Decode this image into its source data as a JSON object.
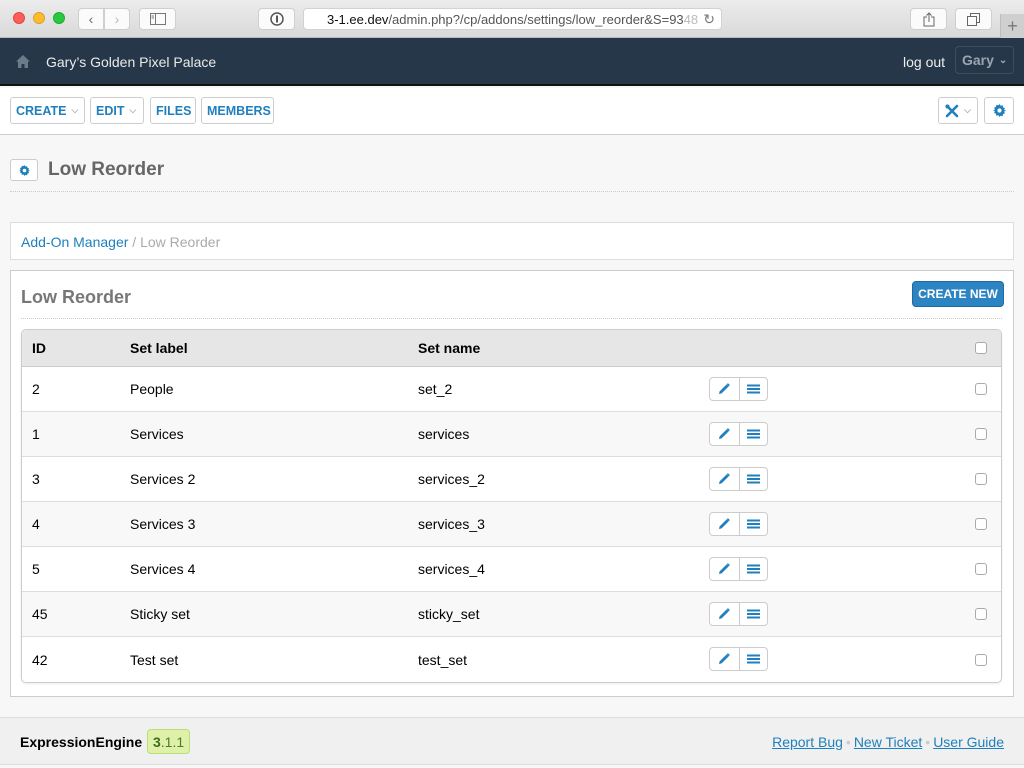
{
  "browser": {
    "url_host": "3-1.ee.dev",
    "url_path": "/admin.php?/cp/addons/settings/low_reorder&S=93",
    "url_fade": "48"
  },
  "header": {
    "site_name": "Gary’s Golden Pixel Palace",
    "logout_label": "log out",
    "user_label": "Gary"
  },
  "nav": {
    "create_label": "CREATE",
    "edit_label": "EDIT",
    "files_label": "FILES",
    "members_label": "MEMBERS"
  },
  "page": {
    "title": "Low Reorder"
  },
  "breadcrumb": {
    "parent": "Add-On Manager",
    "separator": " / ",
    "current": "Low Reorder"
  },
  "panel": {
    "title": "Low Reorder",
    "create_new_label": "CREATE NEW"
  },
  "table": {
    "columns": [
      "ID",
      "Set label",
      "Set name"
    ],
    "rows": [
      {
        "id": "2",
        "label": "People",
        "name": "set_2"
      },
      {
        "id": "1",
        "label": "Services",
        "name": "services"
      },
      {
        "id": "3",
        "label": "Services 2",
        "name": "services_2"
      },
      {
        "id": "4",
        "label": "Services 3",
        "name": "services_3"
      },
      {
        "id": "5",
        "label": "Services 4",
        "name": "services_4"
      },
      {
        "id": "45",
        "label": "Sticky set",
        "name": "sticky_set"
      },
      {
        "id": "42",
        "label": "Test set",
        "name": "test_set"
      }
    ]
  },
  "footer": {
    "brand": "ExpressionEngine",
    "version_major": "3",
    "version_rest": ".1.1",
    "links": [
      "Report Bug",
      "New Ticket",
      "User Guide"
    ]
  },
  "colors": {
    "accent": "#1f80bd",
    "header_bg": "#253748",
    "button_primary": "#2c84c3",
    "version_badge_bg": "#dff0a9"
  }
}
